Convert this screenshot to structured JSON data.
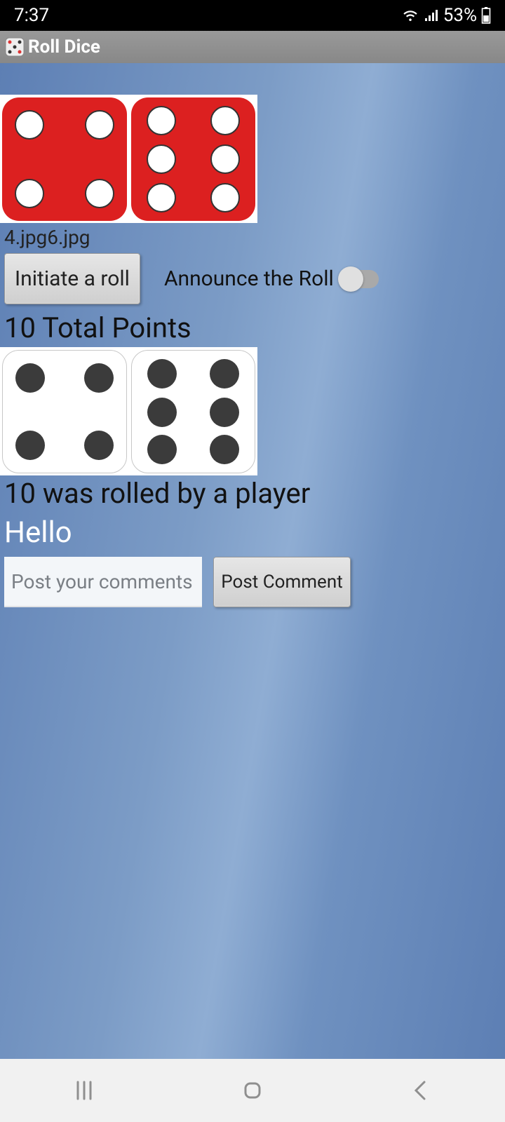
{
  "status": {
    "time": "7:37",
    "battery": "53%"
  },
  "app": {
    "title": "Roll Dice"
  },
  "dice": {
    "red_values": [
      4,
      6
    ],
    "filenames": "4.jpg6.jpg",
    "white_values": [
      4,
      6
    ]
  },
  "controls": {
    "roll_button": "Initiate a roll",
    "announce_label": "Announce the Roll",
    "announce_on": false
  },
  "total": {
    "label": "10  Total Points"
  },
  "result_text": "10 was rolled by a player",
  "greeting": "Hello",
  "comments": {
    "placeholder": "Post your comments",
    "value": "",
    "button": "Post Comment"
  }
}
